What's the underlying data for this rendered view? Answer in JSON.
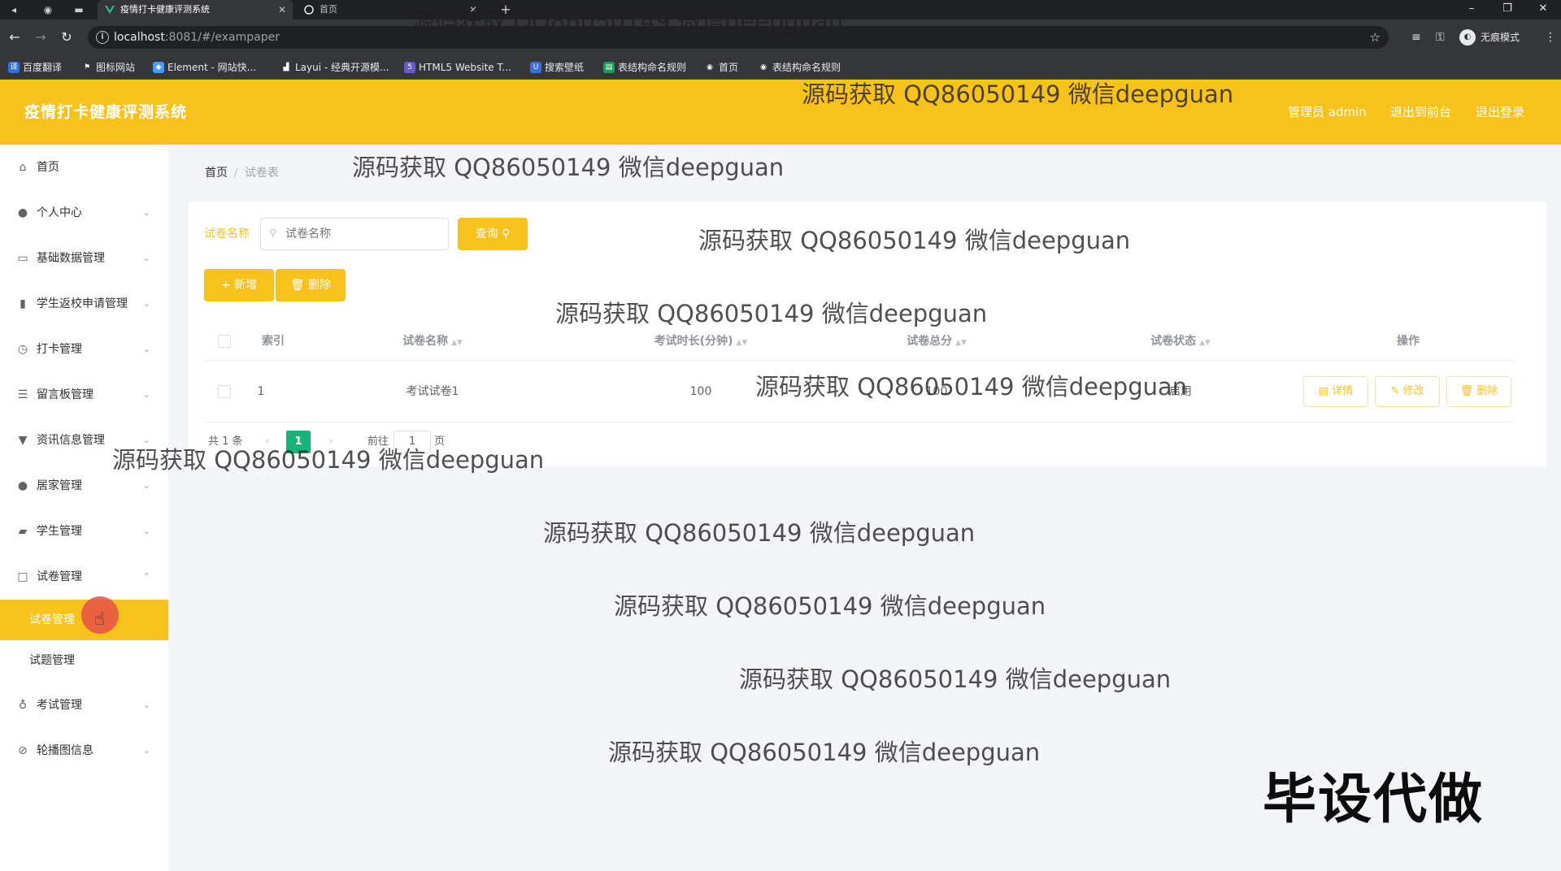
{
  "browser": {
    "tabs": [
      {
        "title": "疫情打卡健康评测系统",
        "active": true
      },
      {
        "title": "首页",
        "active": false
      }
    ],
    "url_host": "localhost",
    "url_rest": ":8081/#/exampaper",
    "incognito_label": "无痕模式",
    "bookmarks": [
      "百度翻译",
      "图标网站",
      "Element - 网站快...",
      "Layui - 经典开源模...",
      "HTML5 Website T...",
      "搜索壁纸",
      "表结构命名规则",
      "首页",
      "表结构命名规则"
    ]
  },
  "header": {
    "title": "疫情打卡健康评测系统",
    "user": "管理员 admin",
    "back_front": "退出到前台",
    "logout": "退出登录"
  },
  "sidebar": {
    "items": [
      {
        "label": "首页",
        "icon": "home-icon"
      },
      {
        "label": "个人中心",
        "icon": "user-icon"
      },
      {
        "label": "基础数据管理",
        "icon": "data-icon"
      },
      {
        "label": "学生返校申请管理",
        "icon": "bar-chart-icon"
      },
      {
        "label": "打卡管理",
        "icon": "clock-icon"
      },
      {
        "label": "留言板管理",
        "icon": "sliders-icon"
      },
      {
        "label": "资讯信息管理",
        "icon": "news-icon"
      },
      {
        "label": "居家管理",
        "icon": "person-icon"
      },
      {
        "label": "学生管理",
        "icon": "student-icon"
      },
      {
        "label": "试卷管理",
        "icon": "paper-icon"
      },
      {
        "label": "考试管理",
        "icon": "mic-icon"
      },
      {
        "label": "轮播图信息",
        "icon": "image-icon"
      }
    ],
    "sub_items": [
      {
        "label": "试卷管理",
        "active": true
      },
      {
        "label": "试题管理",
        "active": false
      }
    ]
  },
  "breadcrumb": {
    "home": "首页",
    "sep": "/",
    "current": "试卷表"
  },
  "search": {
    "label": "试卷名称",
    "placeholder": "试卷名称",
    "query_button": "查询"
  },
  "actions": {
    "add": "新增",
    "delete": "删除"
  },
  "table": {
    "columns": [
      "索引",
      "试卷名称",
      "考试时长(分钟)",
      "试卷总分",
      "试卷状态",
      "操作"
    ],
    "rows": [
      {
        "index": "1",
        "name": "考试试卷1",
        "duration": "100",
        "total": "100",
        "status": "启用"
      }
    ],
    "row_actions": [
      "详情",
      "修改",
      "删除"
    ]
  },
  "pagination": {
    "total": "共 1 条",
    "current_page": "1",
    "goto_prefix": "前往",
    "goto_value": "1",
    "goto_suffix": "页"
  },
  "watermarks": {
    "text": "源码获取 QQ86050149 微信deepguan",
    "badge": "毕设代做"
  },
  "colors": {
    "accent": "#f8c21d",
    "page_active": "#19b37a"
  }
}
